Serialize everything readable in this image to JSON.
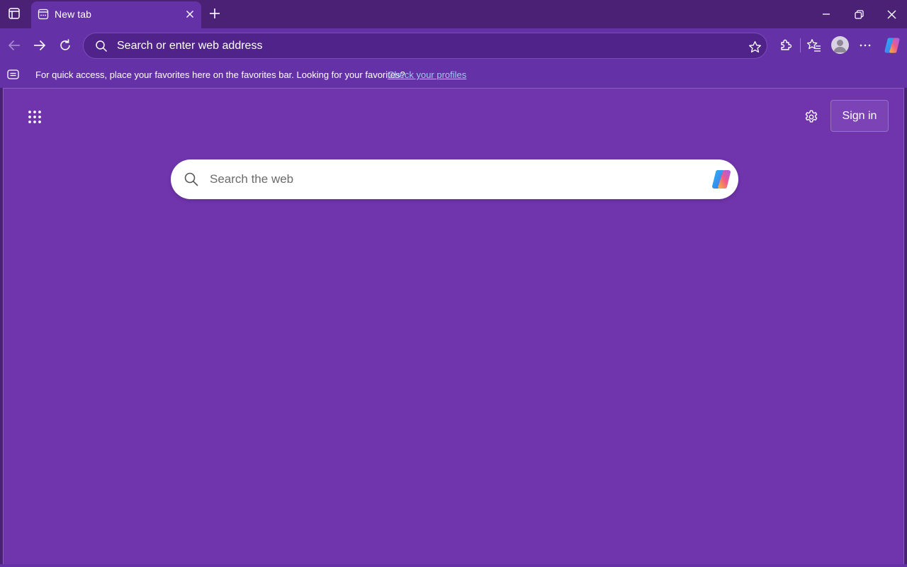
{
  "tab": {
    "title": "New tab"
  },
  "omnibox": {
    "placeholder": "Search or enter web address"
  },
  "favorites_bar": {
    "message": "For quick access, place your favorites here on the favorites bar. Looking for your favorites?",
    "link": "Check your profiles"
  },
  "page": {
    "sign_in": "Sign in",
    "search_placeholder": "Search the web"
  },
  "icons": {
    "tab_actions": "tab-actions-icon",
    "new_tab": "plus-icon",
    "minimize": "minimize-icon",
    "restore": "restore-icon",
    "close": "close-icon",
    "back": "back-arrow-icon",
    "forward": "forward-arrow-icon",
    "refresh": "refresh-icon",
    "extensions": "puzzle-icon",
    "favorites": "favorites-icon",
    "profile": "avatar-icon",
    "more": "more-icon",
    "copilot": "copilot-icon",
    "apps": "apps-grid-icon",
    "settings": "gear-icon"
  },
  "colors": {
    "titlebar": "#4b2176",
    "toolbar": "#6432a6",
    "content_bg": "#7035ad",
    "link": "#a7c7f5"
  }
}
